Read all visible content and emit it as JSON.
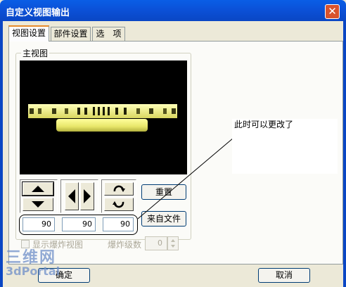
{
  "window": {
    "title": "自定义视图输出",
    "close_label": "✕"
  },
  "tabs": [
    {
      "label": "视图设置",
      "active": true
    },
    {
      "label": "部件设置",
      "active": false
    },
    {
      "label": "选　项",
      "active": false
    }
  ],
  "main_view": {
    "group_label": "主视图"
  },
  "buttons": {
    "reset": "重置",
    "from_file": "来自文件",
    "ok": "确定",
    "cancel": "取消"
  },
  "rotation_fields": [
    "90",
    "90",
    "90"
  ],
  "exploded": {
    "show_label": "显示爆炸视图",
    "checked": false,
    "level_label": "爆炸级数",
    "level_value": "0"
  },
  "annotation": {
    "text": "此时可以更改了"
  },
  "watermark": {
    "line1": "三维网",
    "line2": "3dPortal"
  },
  "colors": {
    "title_bar": "#0A52D8",
    "dialog_bg": "#ECE9D8",
    "model_yellow": "#F2F27A",
    "viewport_bg": "#000000"
  },
  "icons": [
    "close-icon",
    "arrow-up-icon",
    "arrow-down-icon",
    "arrow-left-icon",
    "arrow-right-icon",
    "rotate-cw-icon",
    "rotate-ccw-icon",
    "spin-up-icon",
    "spin-down-icon"
  ]
}
